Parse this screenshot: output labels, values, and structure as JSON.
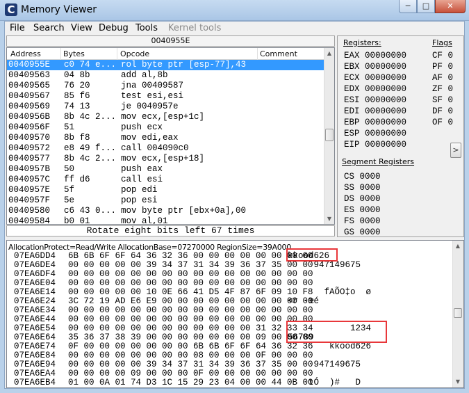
{
  "window": {
    "title": "Memory Viewer",
    "icon": "cheat-engine-logo",
    "minimize": "─",
    "maximize": "□",
    "close": "✕"
  },
  "menu": [
    "File",
    "Search",
    "View",
    "Debug",
    "Tools",
    "Kernel tools"
  ],
  "disasm": {
    "address_bar": "0040955E",
    "columns": {
      "address": "Address",
      "bytes": "Bytes",
      "opcode": "Opcode",
      "comment": "Comment"
    },
    "rows": [
      {
        "addr": "0040955E",
        "bytes": "c0 74 e...",
        "op": "rol byte ptr [esp-77],43"
      },
      {
        "addr": "00409563",
        "bytes": "04 8b",
        "op": "add al,8b"
      },
      {
        "addr": "00409565",
        "bytes": "76 20",
        "op": "jna 00409587"
      },
      {
        "addr": "00409567",
        "bytes": "85 f6",
        "op": "test esi,esi"
      },
      {
        "addr": "00409569",
        "bytes": "74 13",
        "op": "je 0040957e"
      },
      {
        "addr": "0040956B",
        "bytes": "8b 4c 2...",
        "op": "mov ecx,[esp+1c]"
      },
      {
        "addr": "0040956F",
        "bytes": "51",
        "op": "push ecx"
      },
      {
        "addr": "00409570",
        "bytes": "8b f8",
        "op": "mov edi,eax"
      },
      {
        "addr": "00409572",
        "bytes": "e8 49 f...",
        "op": "call 004090c0"
      },
      {
        "addr": "00409577",
        "bytes": "8b 4c 2...",
        "op": "mov ecx,[esp+18]"
      },
      {
        "addr": "0040957B",
        "bytes": "50",
        "op": "push eax"
      },
      {
        "addr": "0040957C",
        "bytes": "ff d6",
        "op": "call esi"
      },
      {
        "addr": "0040957E",
        "bytes": "5f",
        "op": "pop edi"
      },
      {
        "addr": "0040957F",
        "bytes": "5e",
        "op": "pop esi"
      },
      {
        "addr": "00409580",
        "bytes": "c6 43 0...",
        "op": "mov byte ptr [ebx+0a],00"
      },
      {
        "addr": "00409584",
        "bytes": "b0 01",
        "op": "mov al,01"
      }
    ],
    "status": "Rotate eight bits left 67 times"
  },
  "registers": {
    "title": "Registers:",
    "flags_title": "Flags",
    "regs": [
      {
        "name": "EAX",
        "value": "00000000"
      },
      {
        "name": "EBX",
        "value": "00000000"
      },
      {
        "name": "ECX",
        "value": "00000000"
      },
      {
        "name": "EDX",
        "value": "00000000"
      },
      {
        "name": "ESI",
        "value": "00000000"
      },
      {
        "name": "EDI",
        "value": "00000000"
      },
      {
        "name": "EBP",
        "value": "00000000"
      },
      {
        "name": "ESP",
        "value": "00000000"
      },
      {
        "name": "EIP",
        "value": "00000000"
      }
    ],
    "flags": [
      {
        "name": "CF",
        "value": "0"
      },
      {
        "name": "PF",
        "value": "0"
      },
      {
        "name": "AF",
        "value": "0"
      },
      {
        "name": "ZF",
        "value": "0"
      },
      {
        "name": "SF",
        "value": "0"
      },
      {
        "name": "DF",
        "value": "0"
      },
      {
        "name": "OF",
        "value": "0"
      }
    ],
    "segment_title": "Segment Registers",
    "segments": [
      {
        "name": "CS",
        "value": "0000"
      },
      {
        "name": "SS",
        "value": "0000"
      },
      {
        "name": "DS",
        "value": "0000"
      },
      {
        "name": "ES",
        "value": "0000"
      },
      {
        "name": "FS",
        "value": "0000"
      },
      {
        "name": "GS",
        "value": "0000"
      }
    ],
    "expand_arrow": ">"
  },
  "hex": {
    "info": "AllocationProtect=Read/Write  AllocationBase=07270000  RegionSize=39A000",
    "rows": [
      {
        "addr": "07EA6DD4",
        "bytes": "6B 6B 6F 6F 64 36 32 36 00 00 00 00 00 00 00 00",
        "text": "kkood626"
      },
      {
        "addr": "07EA6DE4",
        "bytes": "00 00 00 00 00 39 34 37 31 34 39 36 37 35 00 00",
        "text": "     947149675"
      },
      {
        "addr": "07EA6DF4",
        "bytes": "00 00 00 00 00 00 00 00 00 00 00 00 00 00 00 00",
        "text": ""
      },
      {
        "addr": "07EA6E04",
        "bytes": "00 00 00 00 00 00 00 00 00 00 00 00 00 00 00 00",
        "text": ""
      },
      {
        "addr": "07EA6E14",
        "bytes": "00 00 00 00 00 10 0E 66 41 D5 4F 87 6F 09 10 F8",
        "text": "       fAÕO‡o  ø"
      },
      {
        "addr": "07EA6E24",
        "bytes": "3C 72 19 AD E6 E9 00 00 00 00 00 00 00 00 00 00",
        "text": "<r -æé"
      },
      {
        "addr": "07EA6E34",
        "bytes": "00 00 00 00 00 00 00 00 00 00 00 00 00 00 00 00",
        "text": ""
      },
      {
        "addr": "07EA6E44",
        "bytes": "00 00 00 00 00 00 00 00 00 00 00 00 00 00 00 00",
        "text": ""
      },
      {
        "addr": "07EA6E54",
        "bytes": "00 00 00 00 00 00 00 00 00 00 00 00 31 32 33 34",
        "text": "            1234"
      },
      {
        "addr": "07EA6E64",
        "bytes": "35 36 37 38 39 00 00 00 00 00 00 00 09 00 00 00",
        "text": "56789"
      },
      {
        "addr": "07EA6E74",
        "bytes": "0F 00 00 00 00 00 00 00 6B 6B 6F 6F 64 36 32 36",
        "text": "        kkood626"
      },
      {
        "addr": "07EA6E84",
        "bytes": "00 00 00 00 00 00 00 00 08 00 00 00 0F 00 00 00",
        "text": ""
      },
      {
        "addr": "07EA6E94",
        "bytes": "00 00 00 00 00 39 34 37 31 34 39 36 37 35 00 00",
        "text": "     947149675"
      },
      {
        "addr": "07EA6EA4",
        "bytes": "00 00 00 00 09 00 00 00 0F 00 00 00 00 00 00 00",
        "text": ""
      },
      {
        "addr": "07EA6EB4",
        "bytes": "01 00 0A 01 74 D3 1C 15 29 23 04 00 00 44 0B 00",
        "text": "    tÓ  )#   D"
      }
    ]
  },
  "highlight_color": "#e8373a",
  "selection_color": "#3399ff"
}
